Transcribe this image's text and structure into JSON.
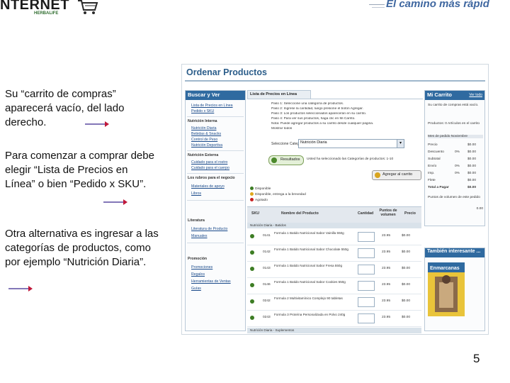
{
  "header": {
    "logo_text": "NTERNET",
    "logo_sub": "HERBALIFE",
    "slogan": "El camino más rápid"
  },
  "instructions": {
    "p1": "Su “carrito de compras” aparecerá vacío, del lado derecho.",
    "p2": "Para comenzar a comprar debe elegir “Lista de Precios en Línea” o bien “Pedido x SKU”.",
    "p3": "Otra alternativa es ingresar a las categorías de productos, como por ejemplo “Nutrición Diaria”."
  },
  "colors": {
    "accent": "#2f6aa0",
    "arrow": "#5a4aa0",
    "arrow_head": "#c0183a",
    "slogan": "#3f67a0"
  },
  "screenshot": {
    "title": "Ordenar Productos",
    "left_panel": {
      "header": "Buscar y Ver",
      "links_top": [
        "Lista de Precios en Línea",
        "Pedido x SKU"
      ],
      "sections": [
        {
          "title": "Nutrición Interna",
          "links": [
            "Nutrición Diaria",
            "Bebidas & Snacks",
            "Control de Peso",
            "Nutrición Deportiva"
          ]
        },
        {
          "title": "Nutrición Externa",
          "links": [
            "Cuidado para el rostro",
            "Cuidado para el cuerpo"
          ]
        },
        {
          "title": "Los rubros para el negocio",
          "links": [
            "Materiales de apoyo",
            "Libros"
          ]
        },
        {
          "title": "Literatura",
          "links": [
            "Literatura de Producto",
            "Manuales"
          ]
        },
        {
          "title": "Promoción",
          "links": [
            "Promociones",
            "Regalos",
            "Herramientas de Ventas",
            "Guías"
          ]
        }
      ]
    },
    "tab_label": "Lista de Precios en Línea",
    "instructions": [
      "Paso 1: Seleccione una categoría de productos.",
      "Paso 2: Ingrese la cantidad, luego presione el botón Agregar.",
      "Paso 3: Los productos seleccionados aparecerán en su carrito.",
      "Paso 4: Para ver sus productos, haga clic en Mi Carrito.",
      "Nota: Puede agregar productos a su carrito desde cualquier página.",
      "Mostrar todos"
    ],
    "select_label": "Seleccione Categoría",
    "select_value": "Nutrición Diaria",
    "result_button": "Resultados",
    "result_text": "Usted ha seleccionado las Categorías de productos: 1-10",
    "add_button": "Agregar al carrito",
    "legend": [
      "Disponible",
      "Disponible, entrega a la brevedad",
      "Agotado"
    ],
    "table": {
      "headers": [
        "SKU",
        "Nombre del Producto",
        "Cantidad",
        "Puntos de volumen",
        "Precio"
      ],
      "category_rows": [
        "Nutrición Diaria - Batidos",
        "Nutrición Diaria - Suplementos"
      ],
      "rows": [
        {
          "sku": "0141",
          "name": "Formula 1 Batido Nutricional Sabor Vainilla 550g",
          "pts": "23.95",
          "price": "$0.00"
        },
        {
          "sku": "0142",
          "name": "Formula 1 Batido Nutricional Sabor Chocolate 550g",
          "pts": "23.95",
          "price": "$0.00"
        },
        {
          "sku": "0143",
          "name": "Formula 1 Batido Nutricional Sabor Fresa 550g",
          "pts": "23.95",
          "price": "$0.00"
        },
        {
          "sku": "0146",
          "name": "Formula 1 Batido Nutricional Sabor Cookies 550g",
          "pts": "23.95",
          "price": "$0.00"
        },
        {
          "sku": "0242",
          "name": "Formula 2 Multivitamínico Complejo 90 tabletas",
          "pts": "23.95",
          "price": "$0.00"
        },
        {
          "sku": "0243",
          "name": "Formula 3 Proteína Personalizada en Polvo 240g",
          "pts": "23.95",
          "price": "$0.00"
        }
      ]
    },
    "cart": {
      "title": "Mi Carrito",
      "edit_link": "Ver todo",
      "empty_text": "Su carrito de compras está vacío.",
      "items_text": "Productos: 0 Artículos en el carrito",
      "month_label": "Mes de pedido Noviembre",
      "rows": [
        {
          "label": "Precio",
          "pct": "",
          "val": "$0.00"
        },
        {
          "label": "Descuento",
          "pct": "0%",
          "val": "$0.00"
        },
        {
          "label": "Subtotal",
          "pct": "",
          "val": "$0.00"
        },
        {
          "label": "Envío",
          "pct": "0%",
          "val": "$0.00"
        },
        {
          "label": "Imp.",
          "pct": "0%",
          "val": "$0.00"
        },
        {
          "label": "Flete",
          "pct": "",
          "val": "$0.00"
        },
        {
          "label": "Total a Pagar",
          "pct": "",
          "val": "$0.00"
        }
      ],
      "volume_label": "Puntos de volumen de este pedido",
      "volume_value": "0.00"
    },
    "promo_title": "También interesante ...",
    "promo_magazine": "Enmarcanas"
  },
  "page_number": "5"
}
